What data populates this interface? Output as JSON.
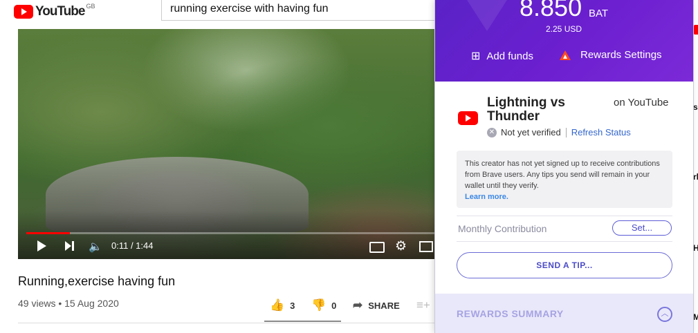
{
  "youtube": {
    "logo_text": "YouTube",
    "logo_region": "GB",
    "search_value": "running exercise with having fun",
    "player": {
      "time": "0:11 / 1:44",
      "progress_fraction": 0.106
    },
    "video_title": "Running,exercise having fun",
    "meta": "49 views • 15 Aug 2020",
    "actions": {
      "likes": "3",
      "dislikes": "0",
      "share_label": "SHARE"
    }
  },
  "rewards_panel": {
    "balance": "8.850",
    "balance_unit": "BAT",
    "usd_value": "2.25 USD",
    "add_funds_label": "Add funds",
    "settings_label": "Rewards Settings",
    "creator": {
      "name": "Lightning vs Thunder",
      "platform_text": "on YouTube",
      "status": "Not yet verified",
      "refresh_label": "Refresh Status"
    },
    "notice": {
      "text": "This creator has not yet signed up to receive contributions from Brave users. Any tips you send will remain in your wallet until they verify.",
      "learn_more": "Learn more."
    },
    "monthly_label": "Monthly Contribution",
    "set_label": "Set...",
    "tip_label": "SEND A TIP...",
    "summary_label": "REWARDS SUMMARY"
  }
}
